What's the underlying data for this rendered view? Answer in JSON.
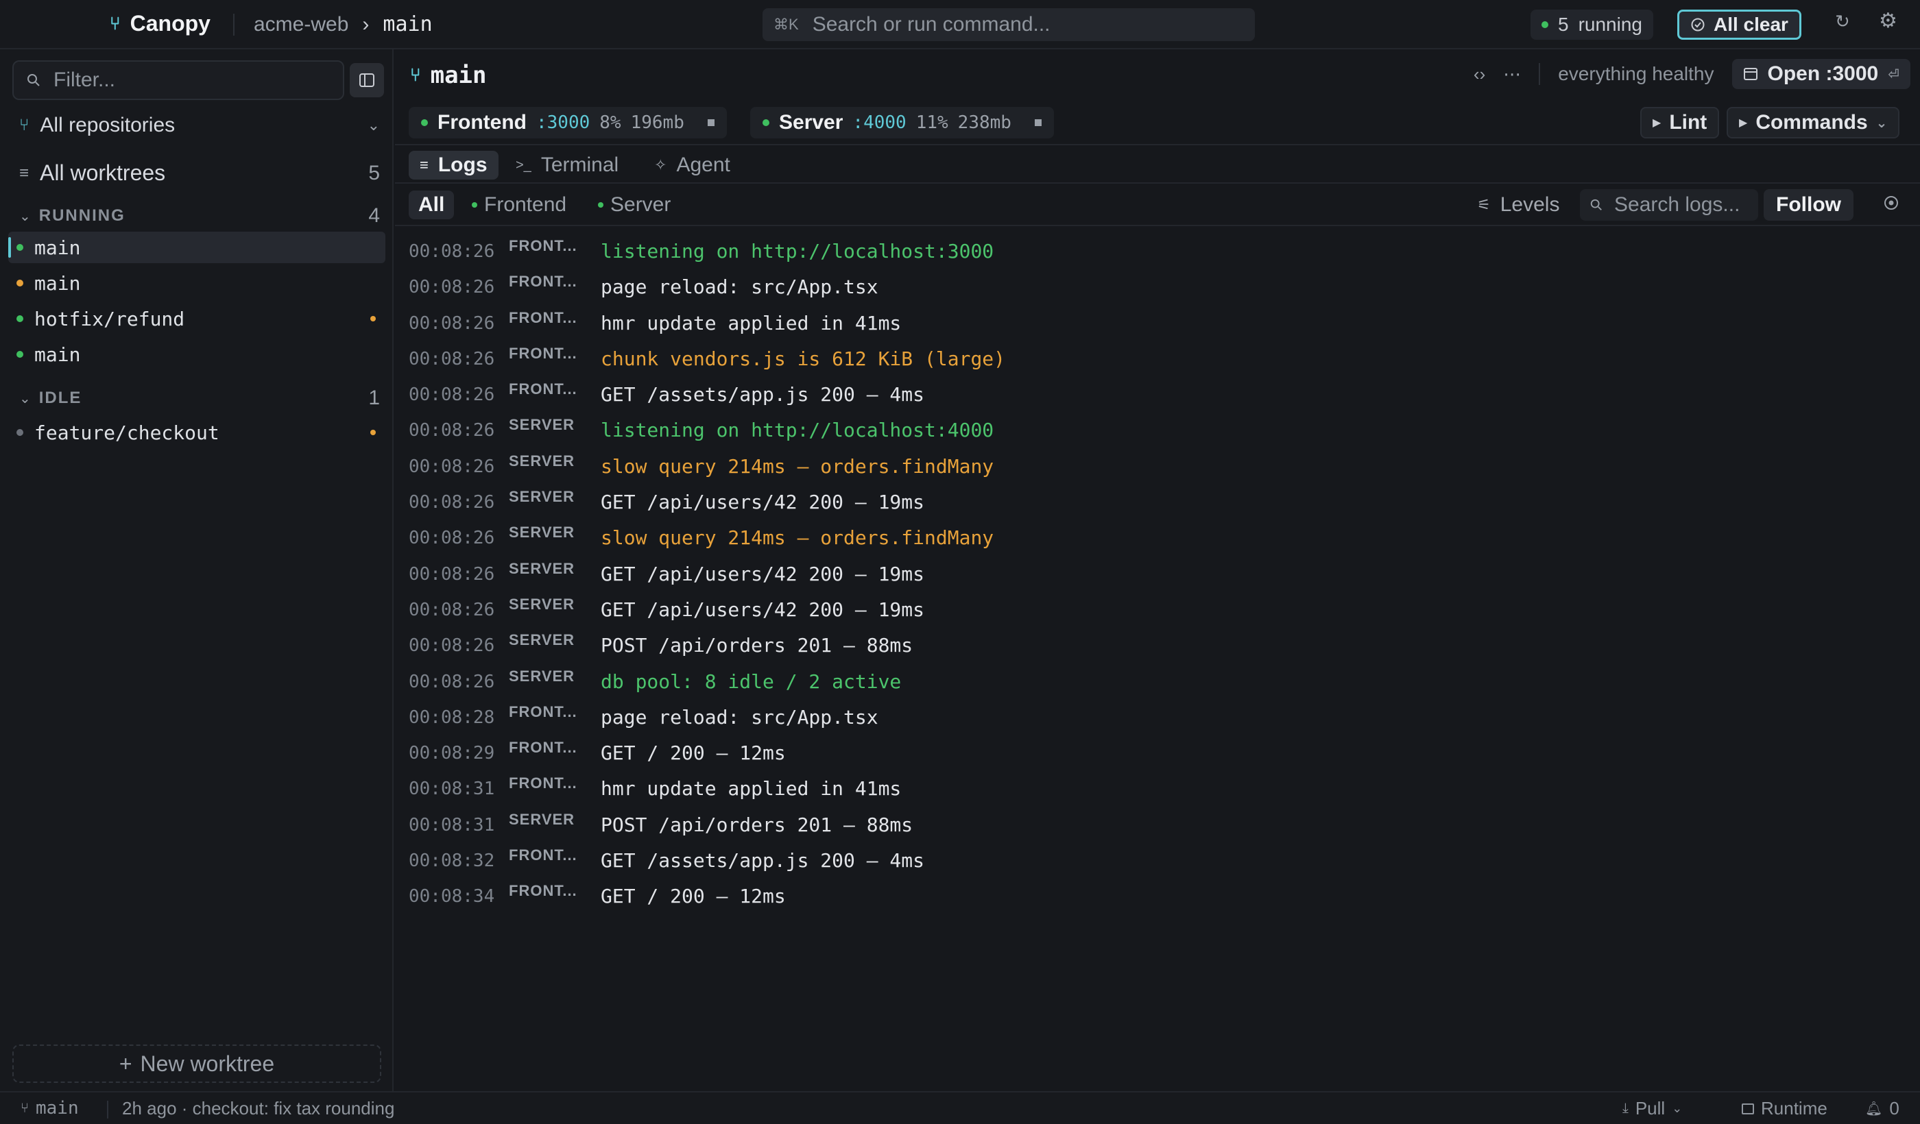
{
  "app": {
    "name": "Canopy"
  },
  "breadcrumb": {
    "repo": "acme-web",
    "separator": "›",
    "branch": "main"
  },
  "command": {
    "shortcut": "⌘K",
    "placeholder": "Search or run command..."
  },
  "status_pill": {
    "count": "5",
    "label": "running"
  },
  "all_clear": {
    "label": "All clear"
  },
  "sidebar": {
    "filter_placeholder": "Filter...",
    "repo_selector": "All repositories",
    "all_worktrees": {
      "label": "All worktrees",
      "count": "5"
    },
    "running_section": {
      "label": "RUNNING",
      "count": "4"
    },
    "running_items": [
      {
        "name": "main",
        "dot": "green",
        "flag": false,
        "active": true
      },
      {
        "name": "main",
        "dot": "orange",
        "flag": false,
        "active": false
      },
      {
        "name": "hotfix/refund",
        "dot": "green",
        "flag": true,
        "active": false
      },
      {
        "name": "main",
        "dot": "green",
        "flag": false,
        "active": false
      }
    ],
    "idle_section": {
      "label": "IDLE",
      "count": "1"
    },
    "idle_items": [
      {
        "name": "feature/checkout",
        "dot": "gray",
        "flag": true,
        "active": false
      }
    ],
    "new_worktree": "New worktree"
  },
  "main": {
    "title": "main",
    "health": "everything healthy",
    "open_button": "Open :3000",
    "services": [
      {
        "name": "Frontend",
        "port": ":3000",
        "cpu": "8%",
        "mem": "196mb"
      },
      {
        "name": "Server",
        "port": ":4000",
        "cpu": "11%",
        "mem": "238mb"
      }
    ],
    "lint_label": "Lint",
    "commands_label": "Commands",
    "tabs": [
      {
        "label": "Logs",
        "icon": "logs-icon",
        "active": true
      },
      {
        "label": "Terminal",
        "icon": "terminal-icon",
        "active": false
      },
      {
        "label": "Agent",
        "icon": "sparkle-icon",
        "active": false
      }
    ],
    "filters": {
      "all": "All",
      "frontend": "Frontend",
      "server": "Server"
    },
    "levels_label": "Levels",
    "log_search_placeholder": "Search logs...",
    "follow_label": "Follow"
  },
  "logs": [
    {
      "time": "00:08:26",
      "source": "FRONT...",
      "message": "listening on http://localhost:3000",
      "level": "ok"
    },
    {
      "time": "00:08:26",
      "source": "FRONT...",
      "message": "page reload: src/App.tsx",
      "level": "info"
    },
    {
      "time": "00:08:26",
      "source": "FRONT...",
      "message": "hmr update applied in 41ms",
      "level": "info"
    },
    {
      "time": "00:08:26",
      "source": "FRONT...",
      "message": "chunk vendors.js is 612 KiB (large)",
      "level": "warn"
    },
    {
      "time": "00:08:26",
      "source": "FRONT...",
      "message": "GET /assets/app.js 200 — 4ms",
      "level": "info"
    },
    {
      "time": "00:08:26",
      "source": "SERVER",
      "message": "listening on http://localhost:4000",
      "level": "ok"
    },
    {
      "time": "00:08:26",
      "source": "SERVER",
      "message": "slow query 214ms — orders.findMany",
      "level": "warn"
    },
    {
      "time": "00:08:26",
      "source": "SERVER",
      "message": "GET /api/users/42 200 — 19ms",
      "level": "info"
    },
    {
      "time": "00:08:26",
      "source": "SERVER",
      "message": "slow query 214ms — orders.findMany",
      "level": "warn"
    },
    {
      "time": "00:08:26",
      "source": "SERVER",
      "message": "GET /api/users/42 200 — 19ms",
      "level": "info"
    },
    {
      "time": "00:08:26",
      "source": "SERVER",
      "message": "GET /api/users/42 200 — 19ms",
      "level": "info"
    },
    {
      "time": "00:08:26",
      "source": "SERVER",
      "message": "POST /api/orders 201 — 88ms",
      "level": "info"
    },
    {
      "time": "00:08:26",
      "source": "SERVER",
      "message": "db pool: 8 idle / 2 active",
      "level": "ok"
    },
    {
      "time": "00:08:28",
      "source": "FRONT...",
      "message": "page reload: src/App.tsx",
      "level": "info"
    },
    {
      "time": "00:08:29",
      "source": "FRONT...",
      "message": "GET / 200 — 12ms",
      "level": "info"
    },
    {
      "time": "00:08:31",
      "source": "FRONT...",
      "message": "hmr update applied in 41ms",
      "level": "info"
    },
    {
      "time": "00:08:31",
      "source": "SERVER",
      "message": "POST /api/orders 201 — 88ms",
      "level": "info"
    },
    {
      "time": "00:08:32",
      "source": "FRONT...",
      "message": "GET /assets/app.js 200 — 4ms",
      "level": "info"
    },
    {
      "time": "00:08:34",
      "source": "FRONT...",
      "message": "GET / 200 — 12ms",
      "level": "info"
    }
  ],
  "statusbar": {
    "branch": "main",
    "commit": "2h ago · checkout: fix tax rounding",
    "pull": "Pull",
    "runtime": "Runtime",
    "notifications": "0"
  },
  "colors": {
    "accent": "#5fc9d6",
    "ok": "#4cc46c",
    "warn": "#e8a23a",
    "background": "#16181c"
  }
}
